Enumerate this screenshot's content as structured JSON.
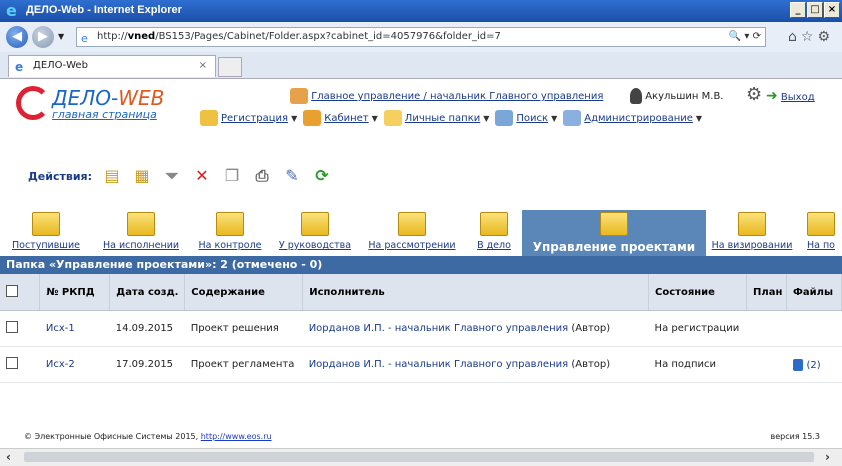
{
  "window": {
    "title": "ДЕЛО-Web - Internet Explorer"
  },
  "browser": {
    "url_prefix": "http://",
    "url_host": "vned",
    "url_path": "/BS153/Pages/Cabinet/Folder.aspx?cabinet_id=4057976&folder_id=7",
    "tab_title": "ДЕЛО-Web"
  },
  "app": {
    "logo_name": "ДЕЛО-",
    "logo_web": "WEB",
    "logo_sub": "главная страница",
    "org": "Главное управление / начальник Главного управления",
    "user": "Акульшин М.В.",
    "exit": "Выход",
    "menu": [
      "Регистрация",
      "Кабинет",
      "Личные папки",
      "Поиск",
      "Администрирование"
    ],
    "actions_label": "Действия:"
  },
  "folders": [
    "Поступившие",
    "На исполнении",
    "На контроле",
    "У руководства",
    "На рассмотрении",
    "В дело",
    "Управление проектами",
    "На визировании",
    "На по"
  ],
  "caption": "Папка «Управление проектами»: 2 (отмечено - 0)",
  "table": {
    "headers": [
      "№ РКПД",
      "Дата созд.",
      "Содержание",
      "Исполнитель",
      "Состояние",
      "План",
      "Файлы"
    ],
    "rows": [
      {
        "num": "Исх-1",
        "date": "14.09.2015",
        "content": "Проект решения",
        "executor": "Иорданов И.П. - начальник Главного управления",
        "role": "(Автор)",
        "state": "На регистрации",
        "files": ""
      },
      {
        "num": "Исх-2",
        "date": "17.09.2015",
        "content": "Проект регламента",
        "executor": "Иорданов И.П. - начальник Главного управления",
        "role": "(Автор)",
        "state": "На подписи",
        "files": "(2)"
      }
    ]
  },
  "footer": {
    "copyright": "© Электронные Офисные Системы 2015,",
    "link": "http://www.eos.ru",
    "version": "версия 15.3"
  }
}
